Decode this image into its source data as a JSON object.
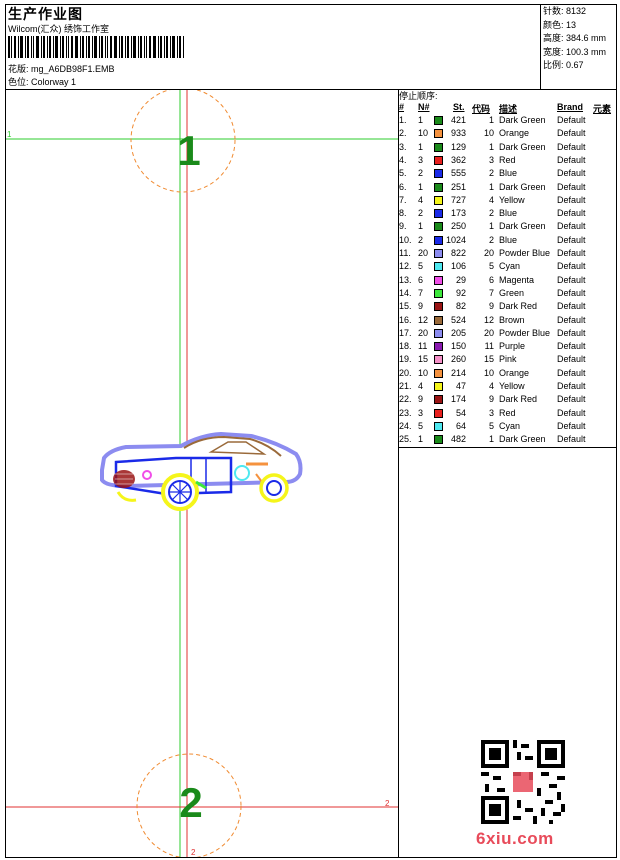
{
  "header": {
    "title": "生产作业图",
    "software": "Wilcom(汇众) 绣饰工作室",
    "design_file_label": "花版: mg_A6DB98F1.EMB",
    "colorway_label": "色位: Colorway 1"
  },
  "stats": {
    "stitches": "针数: 8132",
    "colors": "颜色: 13",
    "height": "高度: 384.6 mm",
    "width": "宽度: 100.3 mm",
    "scale": "比例: 0.67"
  },
  "markers": {
    "top_number": "1",
    "bottom_number": "2",
    "h_top_left": "1",
    "h_bottom_right": "2",
    "v_bottom": "2"
  },
  "table": {
    "title": "停止顺序:",
    "headers": {
      "num": "#",
      "n": "N#",
      "st": "St.",
      "code": "代码",
      "desc": "描述",
      "brand": "Brand",
      "element": "元素"
    },
    "rows": [
      {
        "i": "1.",
        "n": "1",
        "color": "#1a8a1a",
        "st": "421",
        "code": "1",
        "desc": "Dark Green",
        "brand": "Default"
      },
      {
        "i": "2.",
        "n": "10",
        "color": "#f5923e",
        "st": "933",
        "code": "10",
        "desc": "Orange",
        "brand": "Default"
      },
      {
        "i": "3.",
        "n": "1",
        "color": "#1a8a1a",
        "st": "129",
        "code": "1",
        "desc": "Dark Green",
        "brand": "Default"
      },
      {
        "i": "4.",
        "n": "3",
        "color": "#e8201e",
        "st": "362",
        "code": "3",
        "desc": "Red",
        "brand": "Default"
      },
      {
        "i": "5.",
        "n": "2",
        "color": "#1a2ae8",
        "st": "555",
        "code": "2",
        "desc": "Blue",
        "brand": "Default"
      },
      {
        "i": "6.",
        "n": "1",
        "color": "#1a8a1a",
        "st": "251",
        "code": "1",
        "desc": "Dark Green",
        "brand": "Default"
      },
      {
        "i": "7.",
        "n": "4",
        "color": "#f5f51a",
        "st": "727",
        "code": "4",
        "desc": "Yellow",
        "brand": "Default"
      },
      {
        "i": "8.",
        "n": "2",
        "color": "#1a2ae8",
        "st": "173",
        "code": "2",
        "desc": "Blue",
        "brand": "Default"
      },
      {
        "i": "9.",
        "n": "1",
        "color": "#1a8a1a",
        "st": "250",
        "code": "1",
        "desc": "Dark Green",
        "brand": "Default"
      },
      {
        "i": "10.",
        "n": "2",
        "color": "#1a2ae8",
        "st": "1024",
        "code": "2",
        "desc": "Blue",
        "brand": "Default"
      },
      {
        "i": "11.",
        "n": "20",
        "color": "#8c8cf0",
        "st": "822",
        "code": "20",
        "desc": "Powder Blue",
        "brand": "Default"
      },
      {
        "i": "12.",
        "n": "5",
        "color": "#4ee8f0",
        "st": "106",
        "code": "5",
        "desc": "Cyan",
        "brand": "Default"
      },
      {
        "i": "13.",
        "n": "6",
        "color": "#f04ee8",
        "st": "29",
        "code": "6",
        "desc": "Magenta",
        "brand": "Default"
      },
      {
        "i": "14.",
        "n": "7",
        "color": "#3ce83c",
        "st": "92",
        "code": "7",
        "desc": "Green",
        "brand": "Default"
      },
      {
        "i": "15.",
        "n": "9",
        "color": "#9a1414",
        "st": "82",
        "code": "9",
        "desc": "Dark Red",
        "brand": "Default"
      },
      {
        "i": "16.",
        "n": "12",
        "color": "#9a6a3a",
        "st": "524",
        "code": "12",
        "desc": "Brown",
        "brand": "Default"
      },
      {
        "i": "17.",
        "n": "20",
        "color": "#8c8cf0",
        "st": "205",
        "code": "20",
        "desc": "Powder Blue",
        "brand": "Default"
      },
      {
        "i": "18.",
        "n": "11",
        "color": "#8a1ab0",
        "st": "150",
        "code": "11",
        "desc": "Purple",
        "brand": "Default"
      },
      {
        "i": "19.",
        "n": "15",
        "color": "#f590c8",
        "st": "260",
        "code": "15",
        "desc": "Pink",
        "brand": "Default"
      },
      {
        "i": "20.",
        "n": "10",
        "color": "#f5923e",
        "st": "214",
        "code": "10",
        "desc": "Orange",
        "brand": "Default"
      },
      {
        "i": "21.",
        "n": "4",
        "color": "#f5f51a",
        "st": "47",
        "code": "4",
        "desc": "Yellow",
        "brand": "Default"
      },
      {
        "i": "22.",
        "n": "9",
        "color": "#9a1414",
        "st": "174",
        "code": "9",
        "desc": "Dark Red",
        "brand": "Default"
      },
      {
        "i": "23.",
        "n": "3",
        "color": "#e8201e",
        "st": "54",
        "code": "3",
        "desc": "Red",
        "brand": "Default"
      },
      {
        "i": "24.",
        "n": "5",
        "color": "#4ee8f0",
        "st": "64",
        "code": "5",
        "desc": "Cyan",
        "brand": "Default"
      },
      {
        "i": "25.",
        "n": "1",
        "color": "#1a8a1a",
        "st": "482",
        "code": "1",
        "desc": "Dark Green",
        "brand": "Default"
      }
    ]
  },
  "watermark": {
    "logo_text": "6xiu.com"
  }
}
